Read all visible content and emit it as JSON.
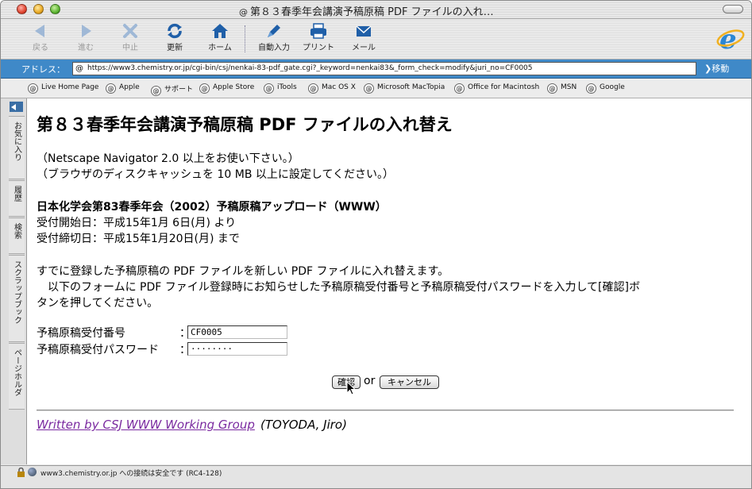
{
  "window": {
    "title": "第８３春季年会講演予稿原稿 PDF ファイルの入れ…"
  },
  "toolbar": {
    "back": "戻る",
    "forward": "進む",
    "stop": "中止",
    "refresh": "更新",
    "home": "ホーム",
    "autofill": "自動入力",
    "print": "プリント",
    "mail": "メール"
  },
  "address": {
    "label": "アドレス：",
    "url": "https://www3.chemistry.or.jp/cgi-bin/csj/nenkai-83-pdf_gate.cgi?_keyword=nenkai83&_form_check=modify&juri_no=CF0005",
    "go": "移動"
  },
  "favorites": [
    "Live Home Page",
    "Apple",
    "サポート",
    "Apple Store",
    "iTools",
    "Mac OS X",
    "Microsoft MacTopia",
    "Office for Macintosh",
    "MSN",
    "Google"
  ],
  "sidebar_tabs": [
    "お気に入り",
    "履歴",
    "検索",
    "スクラップブック",
    "ページホルダ"
  ],
  "page": {
    "title": "第８３春季年会講演予稿原稿 PDF ファイルの入れ替え",
    "note1": "（Netscape Navigator 2.0 以上をお使い下さい。）",
    "note2": "（ブラウザのディスクキャッシュを 10 MB 以上に設定してください。）",
    "event": "日本化学会第83春季年会（2002）予稿原稿アップロード（WWW）",
    "start": "受付開始日：平成15年1月 6日(月) より",
    "end": "受付締切日：平成15年1月20日(月) まで",
    "intro": "すでに登録した予稿原稿の PDF ファイルを新しい PDF ファイルに入れ替えます。",
    "instr1": "　以下のフォームに PDF ファイル登録時にお知らせした予稿原稿受付番号と予稿原稿受付パスワードを入力して[確認]ボ",
    "instr2": "タンを押してください。"
  },
  "form": {
    "number_label": "予稿原稿受付番号",
    "password_label": "予稿原稿受付パスワード",
    "colon": "：",
    "number_value": "CF0005",
    "password_value": "········",
    "confirm": "確認",
    "or": "or",
    "cancel": "キャンセル"
  },
  "footer": {
    "link": "Written by CSJ WWW Working Group",
    "rest": "(TOYODA, Jiro)"
  },
  "status": {
    "text": "www3.chemistry.or.jp への接続は安全です (RC4-128)"
  },
  "colors": {
    "address_bar": "#3f89c8",
    "link_visited": "#7a2aa0",
    "icon_blue": "#1f5fa8"
  }
}
